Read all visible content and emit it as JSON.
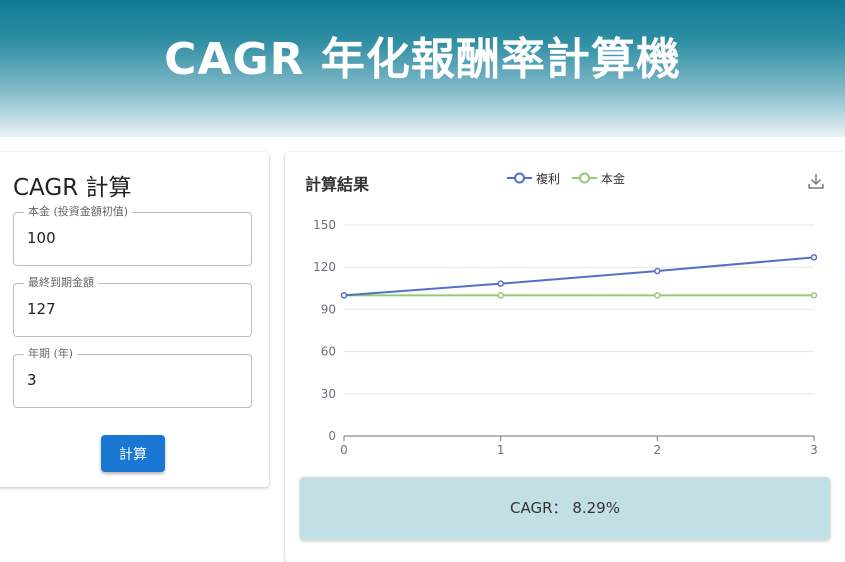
{
  "header": {
    "title": "CAGR 年化報酬率計算機"
  },
  "form": {
    "title": "CAGR 計算",
    "fields": [
      {
        "label": "本金 (投資金額初值)",
        "value": "100"
      },
      {
        "label": "最終到期金額",
        "value": "127"
      },
      {
        "label": "年期 (年)",
        "value": "3"
      }
    ],
    "submit_label": "計算"
  },
  "result": {
    "title": "計算結果",
    "legend": [
      {
        "name": "複利",
        "color": "#5470c6"
      },
      {
        "name": "本金",
        "color": "#91cc75"
      }
    ],
    "download_icon": "download-icon",
    "cagr_label": "CAGR：",
    "cagr_value": "8.29%"
  },
  "chart_data": {
    "type": "line",
    "x": [
      0,
      1,
      2,
      3
    ],
    "series": [
      {
        "name": "複利",
        "values": [
          100,
          108.29,
          117.27,
          127
        ],
        "color": "#5470c6"
      },
      {
        "name": "本金",
        "values": [
          100,
          100,
          100,
          100
        ],
        "color": "#91cc75"
      }
    ],
    "ylim": [
      0,
      150
    ],
    "yticks": [
      0,
      30,
      60,
      90,
      120,
      150
    ],
    "xticks": [
      0,
      1,
      2,
      3
    ],
    "grid": true,
    "legend": "top-center"
  }
}
